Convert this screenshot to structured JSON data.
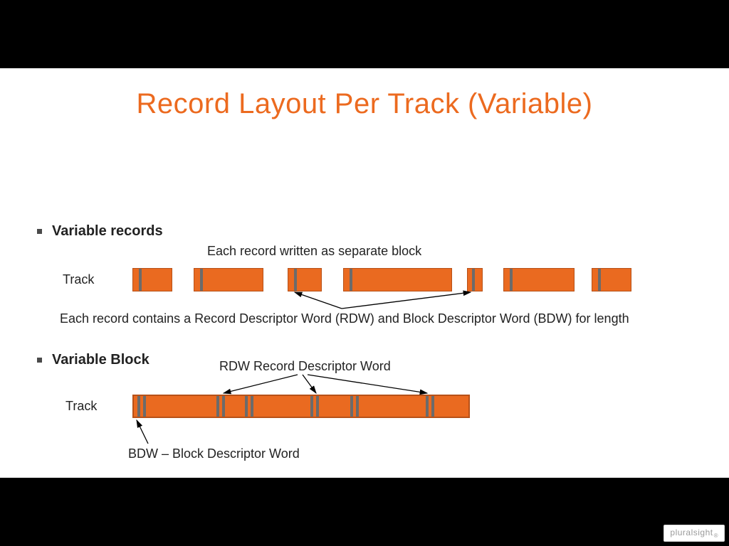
{
  "title": "Record Layout Per Track (Variable)",
  "section1": {
    "heading": "Variable records",
    "caption_top": "Each record written as separate block",
    "track_label": "Track",
    "desc": "Each record contains a Record Descriptor Word (RDW) and Block Descriptor Word (BDW) for length"
  },
  "section2": {
    "heading": "Variable Block",
    "rdw_label": "RDW Record Descriptor Word",
    "track_label": "Track",
    "bdw_label": "BDW – Block Descriptor Word"
  },
  "watermark": "pluralsight"
}
